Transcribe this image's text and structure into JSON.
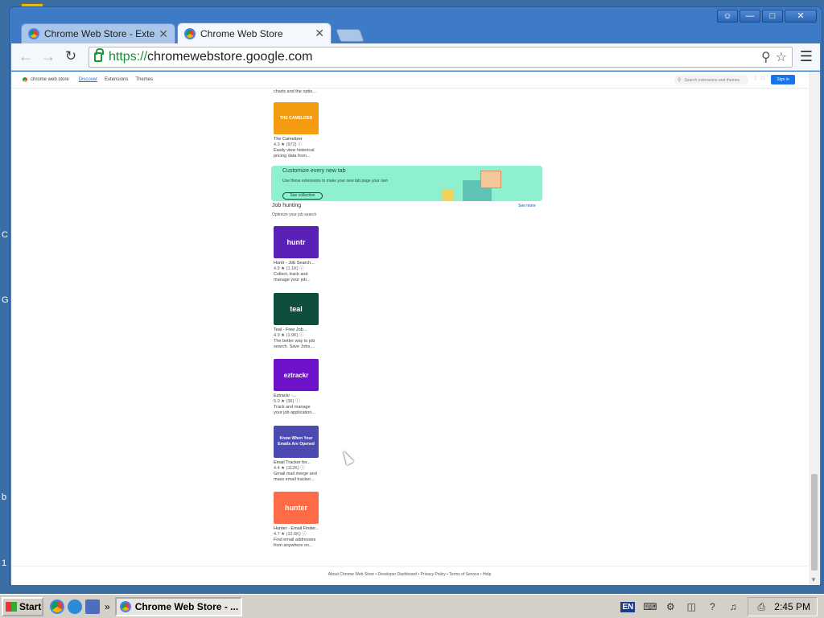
{
  "desktop": {
    "edge_letters": [
      "C",
      "G",
      "b",
      "1"
    ]
  },
  "window": {
    "controls": [
      "person-icon",
      "minimize-icon",
      "maximize-icon",
      "close-icon"
    ]
  },
  "tabs": [
    {
      "title": "Chrome Web Store - Extensio",
      "active": false
    },
    {
      "title": "Chrome Web Store",
      "active": true
    }
  ],
  "toolbar": {
    "url_scheme": "https://",
    "url_host": "chromewebstore.google.com"
  },
  "store_header": {
    "logo_text": "chrome web store",
    "nav": [
      "Discover",
      "Extensions",
      "Themes"
    ],
    "active_nav": "Discover",
    "search_placeholder": "Search extensions and themes",
    "signin_label": "Sign in"
  },
  "top_partial_text": "charts and the optio...",
  "camelizer": {
    "thumb_text": "THE CAMELIZER",
    "thumb_color": "#f39c12",
    "name": "The Camelizer",
    "rating": "4.3 ★ (972) ⓘ",
    "desc1": "Easily view historical",
    "desc2": "pricing data from..."
  },
  "banner": {
    "title": "Customize every new tab",
    "text": "Use these extensions to make your new tab page your own",
    "button": "See collection"
  },
  "section": {
    "title": "Job hunting",
    "subtitle": "Optimize your job search",
    "see_more": "See more"
  },
  "job_cards": [
    {
      "thumb_text": "huntr",
      "thumb_color": "#5b21b6",
      "name": "Huntr - Job Search...",
      "rating": "4.9 ★ (1.1K) ⓘ",
      "desc1": "Collect, track and",
      "desc2": "manage your job..."
    },
    {
      "thumb_text": "teal",
      "thumb_color": "#0f4d3f",
      "name": "Teal - Free Job...",
      "rating": "4.9 ★ (1.9K) ⓘ",
      "desc1": "The better way to job",
      "desc2": "search. Save Jobs,..."
    },
    {
      "thumb_text": "eztrackr",
      "thumb_color": "#6d12c9",
      "name": "Eztrackr -...",
      "rating": "5.0 ★ (36) ⓘ",
      "desc1": "Track and manage",
      "desc2": "your job application..."
    },
    {
      "thumb_text": "Know When Your Emails Are Opened",
      "thumb_color": "#4a4ab0",
      "name": "Email Tracker for...",
      "rating": "4.4 ★ (112K) ⓘ",
      "desc1": "Gmail mail merge and",
      "desc2": "mass email tracker..."
    },
    {
      "thumb_text": "hunter",
      "thumb_color": "#ff6b47",
      "name": "Hunter - Email Finder...",
      "rating": "4.7 ★ (12.6K) ⓘ",
      "desc1": "Find email addresses",
      "desc2": "from anywhere on..."
    }
  ],
  "footer": "About Chrome Web Store • Developer Dashboard • Privacy Policy • Terms of Service • Help",
  "taskbar": {
    "start_label": "Start",
    "chevron": "»",
    "task_title": "Chrome Web Store - ...",
    "language": "EN",
    "tray": [
      "keyboard-icon",
      "network-icon",
      "display-icon",
      "help-icon",
      "speaker-icon",
      "printer-icon"
    ],
    "clock": "2:45 PM"
  }
}
